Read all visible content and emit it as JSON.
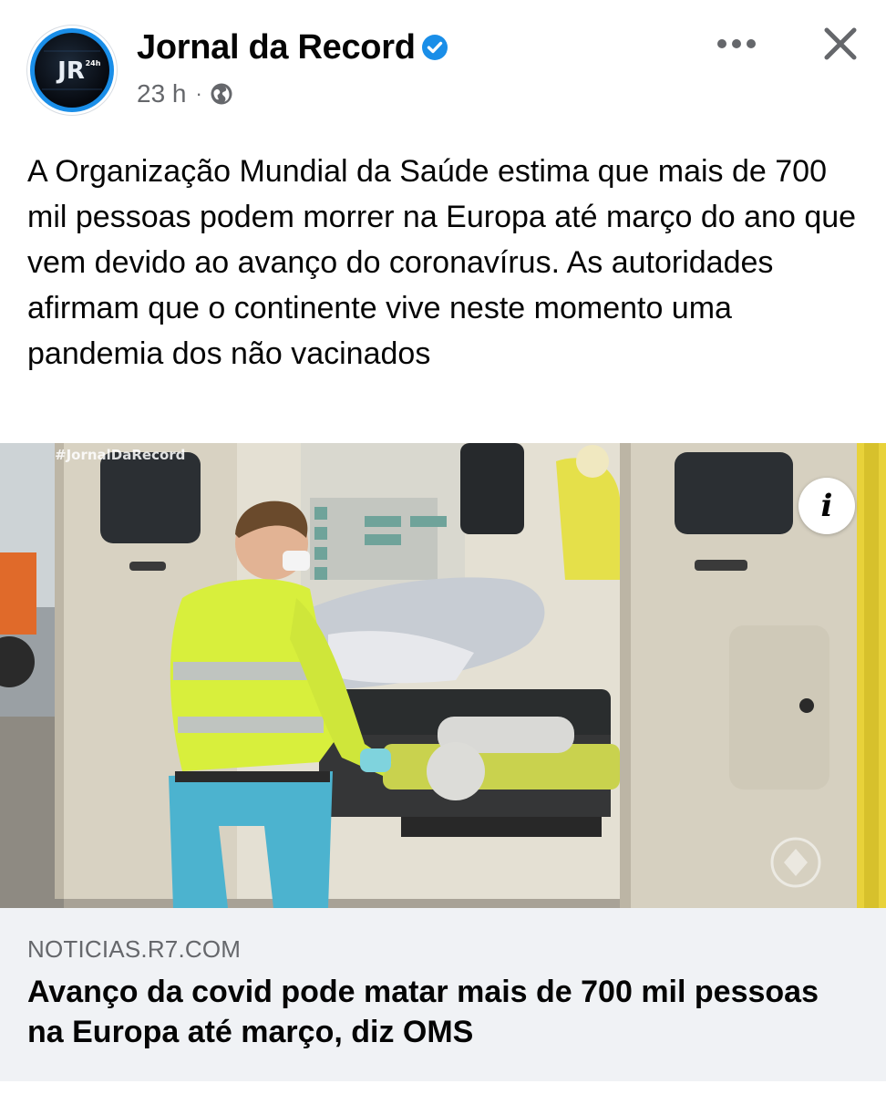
{
  "header": {
    "page_name": "Jornal da Record",
    "time": "23 h",
    "separator": "·",
    "privacy_icon": "globe-icon",
    "verified_icon": "verified-badge-icon",
    "more_icon": "more-options-icon",
    "close_icon": "close-icon",
    "avatar_text": "JR",
    "avatar_badge": "24h"
  },
  "post": {
    "text": "A Organização Mundial da Saúde estima que mais de 700 mil pessoas podem morrer na Europa até março do ano que vem devido ao avanço do coronavírus. As autoridades afirmam que o continente vive neste momento uma pandemia dos não vacinados"
  },
  "image": {
    "watermark": "#JornalDaRecord",
    "info_label": "i"
  },
  "link_preview": {
    "domain": "NOTICIAS.R7.COM",
    "title": "Avanço da covid pode matar mais de 700 mil pessoas na Europa até março, diz OMS"
  },
  "colors": {
    "accent": "#1a8ee8",
    "text": "#050505",
    "secondary": "#65676b",
    "link_bg": "#f0f2f5"
  }
}
